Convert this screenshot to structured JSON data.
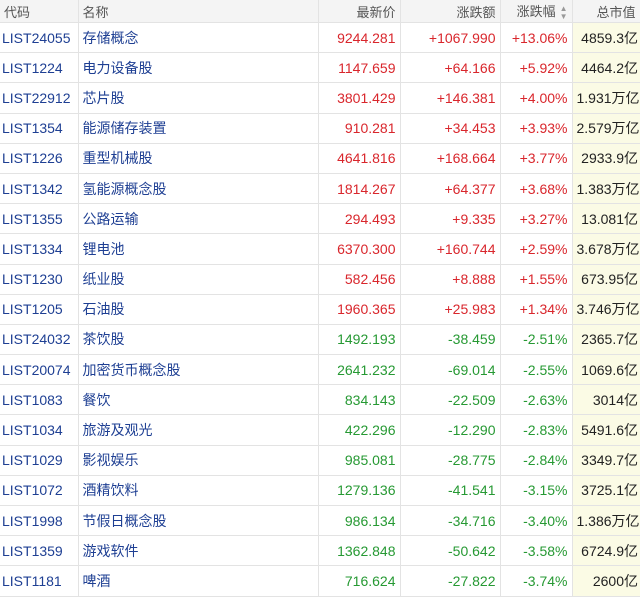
{
  "header": {
    "code": "代码",
    "name": "名称",
    "price": "最新价",
    "change": "涨跌额",
    "pct": "涨跌幅",
    "cap": "总市值"
  },
  "rows": [
    {
      "code": "LIST24055",
      "name": "存储概念",
      "price": "9244.281",
      "change": "+1067.990",
      "pct": "+13.06%",
      "cap": "4859.3亿",
      "dir": "up"
    },
    {
      "code": "LIST1224",
      "name": "电力设备股",
      "price": "1147.659",
      "change": "+64.166",
      "pct": "+5.92%",
      "cap": "4464.2亿",
      "dir": "up"
    },
    {
      "code": "LIST22912",
      "name": "芯片股",
      "price": "3801.429",
      "change": "+146.381",
      "pct": "+4.00%",
      "cap": "1.931万亿",
      "dir": "up"
    },
    {
      "code": "LIST1354",
      "name": "能源储存装置",
      "price": "910.281",
      "change": "+34.453",
      "pct": "+3.93%",
      "cap": "2.579万亿",
      "dir": "up"
    },
    {
      "code": "LIST1226",
      "name": "重型机械股",
      "price": "4641.816",
      "change": "+168.664",
      "pct": "+3.77%",
      "cap": "2933.9亿",
      "dir": "up"
    },
    {
      "code": "LIST1342",
      "name": "氢能源概念股",
      "price": "1814.267",
      "change": "+64.377",
      "pct": "+3.68%",
      "cap": "1.383万亿",
      "dir": "up"
    },
    {
      "code": "LIST1355",
      "name": "公路运输",
      "price": "294.493",
      "change": "+9.335",
      "pct": "+3.27%",
      "cap": "13.081亿",
      "dir": "up"
    },
    {
      "code": "LIST1334",
      "name": "锂电池",
      "price": "6370.300",
      "change": "+160.744",
      "pct": "+2.59%",
      "cap": "3.678万亿",
      "dir": "up"
    },
    {
      "code": "LIST1230",
      "name": "纸业股",
      "price": "582.456",
      "change": "+8.888",
      "pct": "+1.55%",
      "cap": "673.95亿",
      "dir": "up"
    },
    {
      "code": "LIST1205",
      "name": "石油股",
      "price": "1960.365",
      "change": "+25.983",
      "pct": "+1.34%",
      "cap": "3.746万亿",
      "dir": "up"
    },
    {
      "code": "LIST24032",
      "name": "茶饮股",
      "price": "1492.193",
      "change": "-38.459",
      "pct": "-2.51%",
      "cap": "2365.7亿",
      "dir": "down"
    },
    {
      "code": "LIST20074",
      "name": "加密货币概念股",
      "price": "2641.232",
      "change": "-69.014",
      "pct": "-2.55%",
      "cap": "1069.6亿",
      "dir": "down"
    },
    {
      "code": "LIST1083",
      "name": "餐饮",
      "price": "834.143",
      "change": "-22.509",
      "pct": "-2.63%",
      "cap": "3014亿",
      "dir": "down"
    },
    {
      "code": "LIST1034",
      "name": "旅游及观光",
      "price": "422.296",
      "change": "-12.290",
      "pct": "-2.83%",
      "cap": "5491.6亿",
      "dir": "down"
    },
    {
      "code": "LIST1029",
      "name": "影视娱乐",
      "price": "985.081",
      "change": "-28.775",
      "pct": "-2.84%",
      "cap": "3349.7亿",
      "dir": "down"
    },
    {
      "code": "LIST1072",
      "name": "酒精饮料",
      "price": "1279.136",
      "change": "-41.541",
      "pct": "-3.15%",
      "cap": "3725.1亿",
      "dir": "down"
    },
    {
      "code": "LIST1998",
      "name": "节假日概念股",
      "price": "986.134",
      "change": "-34.716",
      "pct": "-3.40%",
      "cap": "1.386万亿",
      "dir": "down"
    },
    {
      "code": "LIST1359",
      "name": "游戏软件",
      "price": "1362.848",
      "change": "-50.642",
      "pct": "-3.58%",
      "cap": "6724.9亿",
      "dir": "down"
    },
    {
      "code": "LIST1181",
      "name": "啤酒",
      "price": "716.624",
      "change": "-27.822",
      "pct": "-3.74%",
      "cap": "2600亿",
      "dir": "down"
    }
  ]
}
